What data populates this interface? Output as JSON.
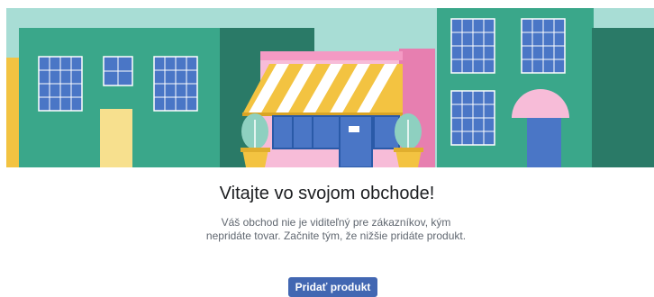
{
  "welcome": {
    "title": "Vitajte vo svojom obchode!",
    "description": "Váš obchod nie je viditeľný pre zákazníkov, kým nepridáte tovar. Začnite tým, že nižšie pridáte produkt.",
    "add_product_label": "Pridať produkt"
  },
  "colors": {
    "accent": "#4267b2",
    "sky": "#a8ddd5",
    "building_green": "#3aa78a",
    "building_dark": "#2a7a67",
    "shop_pink": "#f7bcd8",
    "awning_yellow": "#f3c341",
    "window_blue": "#4a76c6"
  },
  "illustration": {
    "icons": [
      "storefront-icon",
      "plant-icon",
      "awning-icon"
    ]
  }
}
